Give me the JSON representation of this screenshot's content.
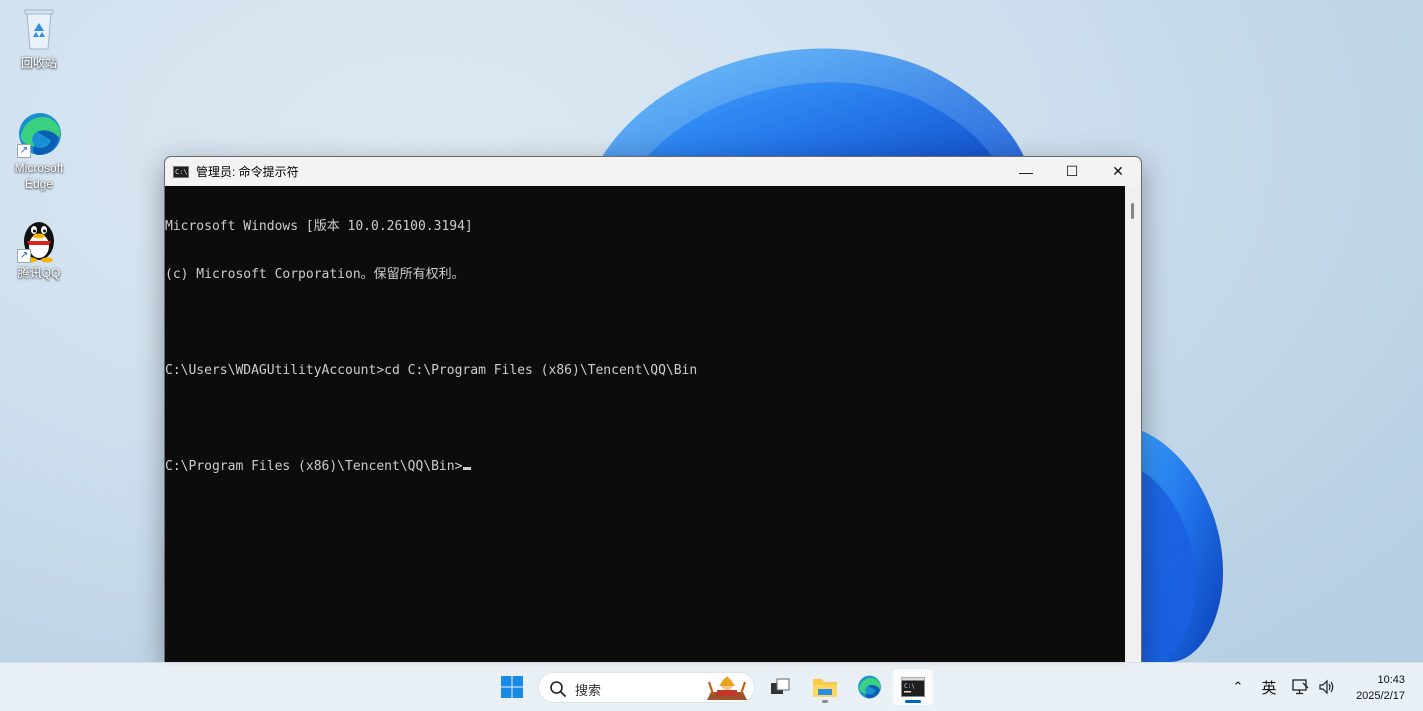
{
  "desktop": {
    "icons": [
      {
        "label": "回收站"
      },
      {
        "label": "Microsoft Edge"
      },
      {
        "label": "腾讯QQ"
      }
    ]
  },
  "cmd_window": {
    "title": "管理员: 命令提示符",
    "controls": {
      "minimize": "—",
      "maximize": "☐",
      "close": "✕"
    },
    "lines": [
      "Microsoft Windows [版本 10.0.26100.3194]",
      "(c) Microsoft Corporation。保留所有权利。",
      "",
      "C:\\Users\\WDAGUtilityAccount>cd C:\\Program Files (x86)\\Tencent\\QQ\\Bin",
      "",
      "C:\\Program Files (x86)\\Tencent\\QQ\\Bin>"
    ]
  },
  "taskbar": {
    "search_placeholder": "搜索",
    "pinned": [
      {
        "name": "task-view"
      },
      {
        "name": "file-explorer"
      },
      {
        "name": "microsoft-edge"
      },
      {
        "name": "command-prompt"
      }
    ],
    "tray": {
      "chevron": "⌃",
      "ime": "英",
      "time": "10:43",
      "date": "2025/2/17"
    }
  },
  "colors": {
    "console_bg": "#0c0c0c",
    "console_text": "#cccccc",
    "accent": "#0067c0"
  }
}
